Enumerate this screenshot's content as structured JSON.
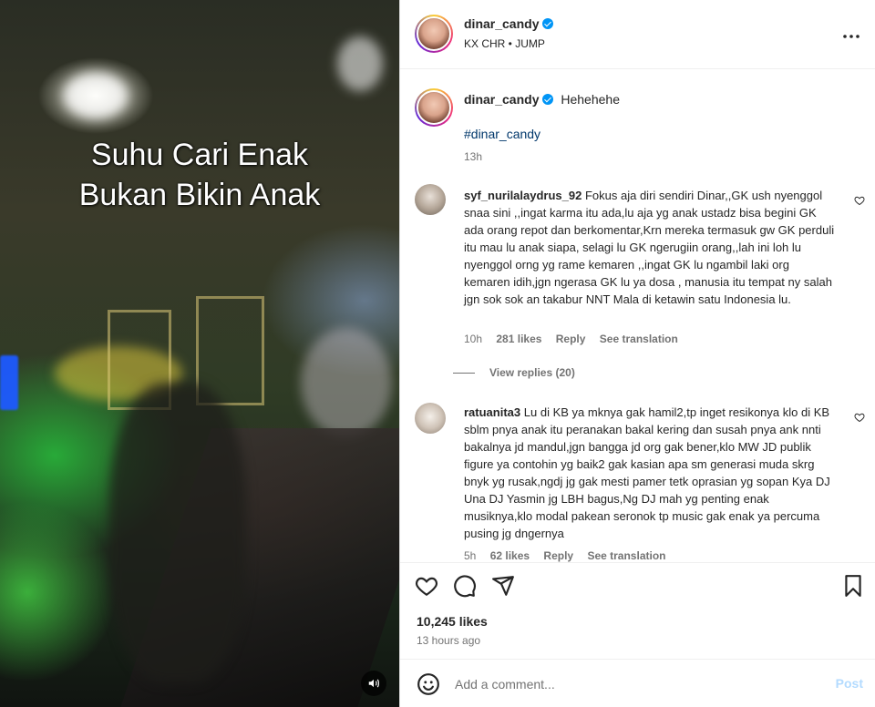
{
  "post": {
    "username": "dinar_candy",
    "audio": "KX CHR • JUMP",
    "media_overlay_line1": "Suhu Cari Enak",
    "media_overlay_line2": "Bukan Bikin Anak"
  },
  "caption": {
    "username": "dinar_candy",
    "text": "Hehehehe",
    "hashtag": "#dinar_candy",
    "time": "13h"
  },
  "comments": [
    {
      "username": "syf_nurilalaydrus_92",
      "text": "Fokus aja diri sendiri Dinar,,GK ush nyenggol snaa sini ,,ingat karma itu ada,lu aja yg anak ustadz bisa begini GK ada orang repot dan berkomentar,Krn mereka termasuk gw GK perduli itu mau lu anak siapa, selagi lu GK ngerugiin orang,,lah ini loh lu nyenggol orng yg rame kemaren ,,ingat GK lu ngambil laki org kemaren idih,jgn ngerasa GK lu ya dosa , manusia itu tempat ny salah jgn sok sok an takabur NNT Mala di ketawin satu Indonesia lu.",
      "time": "10h",
      "likes": "281 likes",
      "reply": "Reply",
      "translate": "See translation",
      "view_replies": "View replies (20)"
    },
    {
      "username": "ratuanita3",
      "text": "Lu di KB ya mknya gak hamil2,tp inget resikonya klo di KB sblm pnya anak itu peranakan bakal kering dan susah pnya ank nnti bakalnya jd mandul,jgn bangga jd org gak bener,klo MW JD publik figure ya contohin yg baik2 gak kasian apa sm generasi muda skrg bnyk yg rusak,ngdj jg gak mesti pamer tetk oprasian yg sopan Kya DJ Una DJ Yasmin jg LBH bagus,Ng DJ mah yg penting enak musiknya,klo modal pakean seronok tp music gak enak ya percuma pusing jg dngernya",
      "time": "5h",
      "likes": "62 likes",
      "reply": "Reply",
      "translate": "See translation"
    }
  ],
  "stats": {
    "likes": "10,245 likes",
    "ago": "13 hours ago"
  },
  "composer": {
    "placeholder": "Add a comment...",
    "post_label": "Post"
  },
  "icons": [
    "heart-icon",
    "comment-icon",
    "share-icon",
    "bookmark-icon",
    "emoji-icon",
    "more-icon",
    "mute-icon",
    "verified-icon"
  ],
  "colors": {
    "link": "#00376b",
    "verified": "#0095f6",
    "post_disabled": "#b3dbff",
    "muted": "#737373"
  }
}
